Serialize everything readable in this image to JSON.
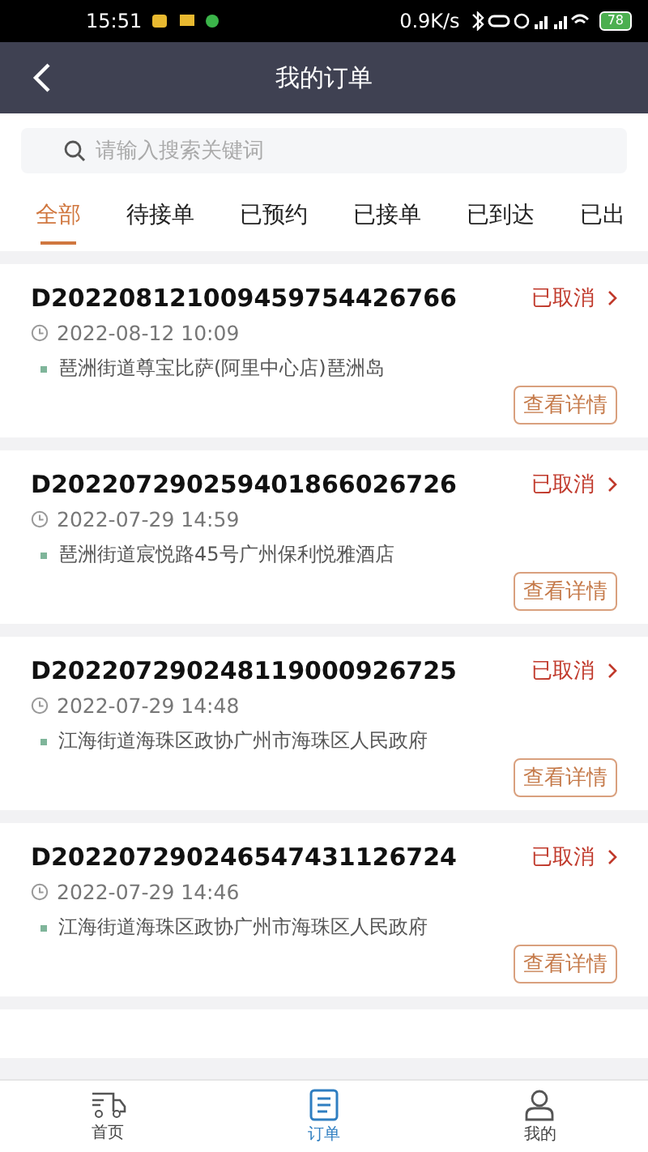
{
  "status_bar": {
    "time": "15:51",
    "speed": "0.9K/s",
    "battery": "78"
  },
  "header": {
    "title": "我的订单"
  },
  "search": {
    "placeholder": "请输入搜索关键词"
  },
  "tabs": [
    {
      "label": "全部",
      "selected": true
    },
    {
      "label": "待接单",
      "selected": false
    },
    {
      "label": "已预约",
      "selected": false
    },
    {
      "label": "已接单",
      "selected": false
    },
    {
      "label": "已到达",
      "selected": false
    },
    {
      "label": "已出",
      "selected": false
    }
  ],
  "orders": [
    {
      "number": "D202208121009459754426766",
      "status": "已取消",
      "time": "2022-08-12 10:09",
      "address": "琶洲街道尊宝比萨(阿里中心店)琶洲岛",
      "action": "查看详情"
    },
    {
      "number": "D202207290259401866026726",
      "status": "已取消",
      "time": "2022-07-29 14:59",
      "address": "琶洲街道宸悦路45号广州保利悦雅酒店",
      "action": "查看详情"
    },
    {
      "number": "D202207290248119000926725",
      "status": "已取消",
      "time": "2022-07-29 14:48",
      "address": "江海街道海珠区政协广州市海珠区人民政府",
      "action": "查看详情"
    },
    {
      "number": "D202207290246547431126724",
      "status": "已取消",
      "time": "2022-07-29 14:46",
      "address": "江海街道海珠区政协广州市海珠区人民政府",
      "action": "查看详情"
    }
  ],
  "bottom_nav": [
    {
      "label": "首页",
      "selected": false,
      "kind": "truck"
    },
    {
      "label": "订单",
      "selected": true,
      "kind": "list"
    },
    {
      "label": "我的",
      "selected": false,
      "kind": "person"
    }
  ]
}
